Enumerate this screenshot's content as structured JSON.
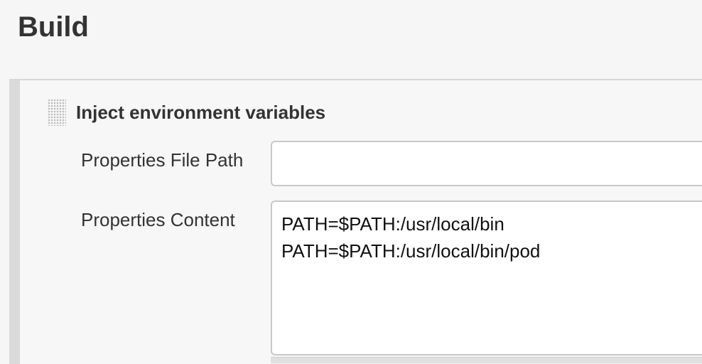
{
  "section": {
    "title": "Build"
  },
  "build_step": {
    "title": "Inject environment variables",
    "drag_handle_icon": "drag-handle-icon",
    "fields": {
      "properties_file_path": {
        "label": "Properties File Path",
        "value": ""
      },
      "properties_content": {
        "label": "Properties Content",
        "value": "PATH=$PATH:/usr/local/bin\nPATH=$PATH:/usr/local/bin/pod"
      }
    }
  },
  "colors": {
    "background": "#f6f6f6",
    "panel_border": "#dadada",
    "input_border": "#c8c8c8",
    "text": "#333333"
  }
}
